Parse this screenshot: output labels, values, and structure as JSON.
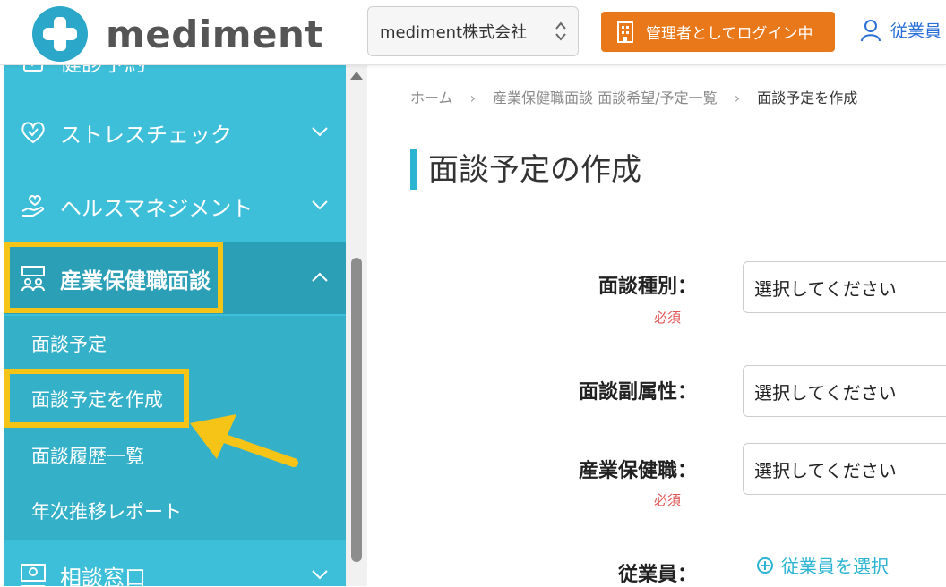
{
  "header": {
    "logo_text": "mediment",
    "company": "mediment株式会社",
    "admin_label": "管理者としてログイン中",
    "employee_link": "従業員"
  },
  "sidebar": {
    "items": [
      {
        "label": "健診予約",
        "icon": "health-check-icon"
      },
      {
        "label": "ストレスチェック",
        "icon": "heart-icon"
      },
      {
        "label": "ヘルスマネジメント",
        "icon": "hand-heart-icon"
      },
      {
        "label": "産業保健職面談",
        "icon": "meeting-icon",
        "active": true
      },
      {
        "label": "相談窓口",
        "icon": "consult-icon"
      }
    ],
    "sub_items": [
      {
        "label": "面談予定"
      },
      {
        "label": "面談予定を作成"
      },
      {
        "label": "面談履歴一覧"
      },
      {
        "label": "年次推移レポート"
      }
    ]
  },
  "breadcrumb": {
    "home": "ホーム",
    "parent": "産業保健職面談 面談希望/予定一覧",
    "current": "面談予定を作成"
  },
  "page_title": "面談予定の作成",
  "form": {
    "required_label": "必須",
    "fields": [
      {
        "label": "面談種別：",
        "placeholder": "選択してください",
        "required": true
      },
      {
        "label": "面談副属性：",
        "placeholder": "選択してください",
        "required": false
      },
      {
        "label": "産業保健職：",
        "placeholder": "選択してください",
        "required": true
      },
      {
        "label": "従業員：",
        "required": false
      }
    ],
    "select_employee": "従業員を選択"
  },
  "colors": {
    "sidebar": "#3ebfd9",
    "sidebar_active": "#2a9fb6",
    "accent": "#2ab4d1",
    "admin_button": "#e8781a",
    "highlight": "#f6c416",
    "required": "#e05555",
    "link": "#2b6fd6"
  }
}
